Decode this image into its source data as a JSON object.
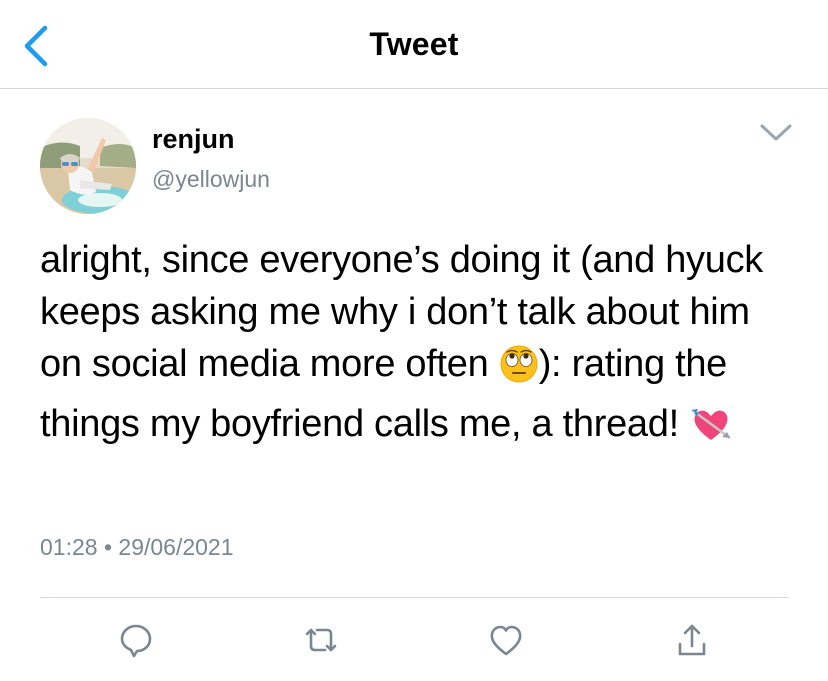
{
  "header": {
    "title": "Tweet"
  },
  "tweet": {
    "author": {
      "display_name": "renjun",
      "handle": "@yellowjun"
    },
    "text": {
      "part1": "alright, since everyone’s doing it (and hyuck keeps asking me why i don’t talk about him on social media more often ",
      "part2": "): rating the things my boyfriend calls me, a thread! "
    },
    "emojis": [
      "face-with-rolling-eyes-emoji",
      "heart-with-arrow-emoji"
    ],
    "time": "01:28",
    "separator": "•",
    "date": "29/06/2021"
  },
  "actions": [
    "reply-icon",
    "retweet-icon",
    "like-icon",
    "share-icon"
  ],
  "colors": {
    "accent": "#1d9bf0",
    "icon_gray": "#7a8690",
    "divider": "#cfd6dc"
  }
}
